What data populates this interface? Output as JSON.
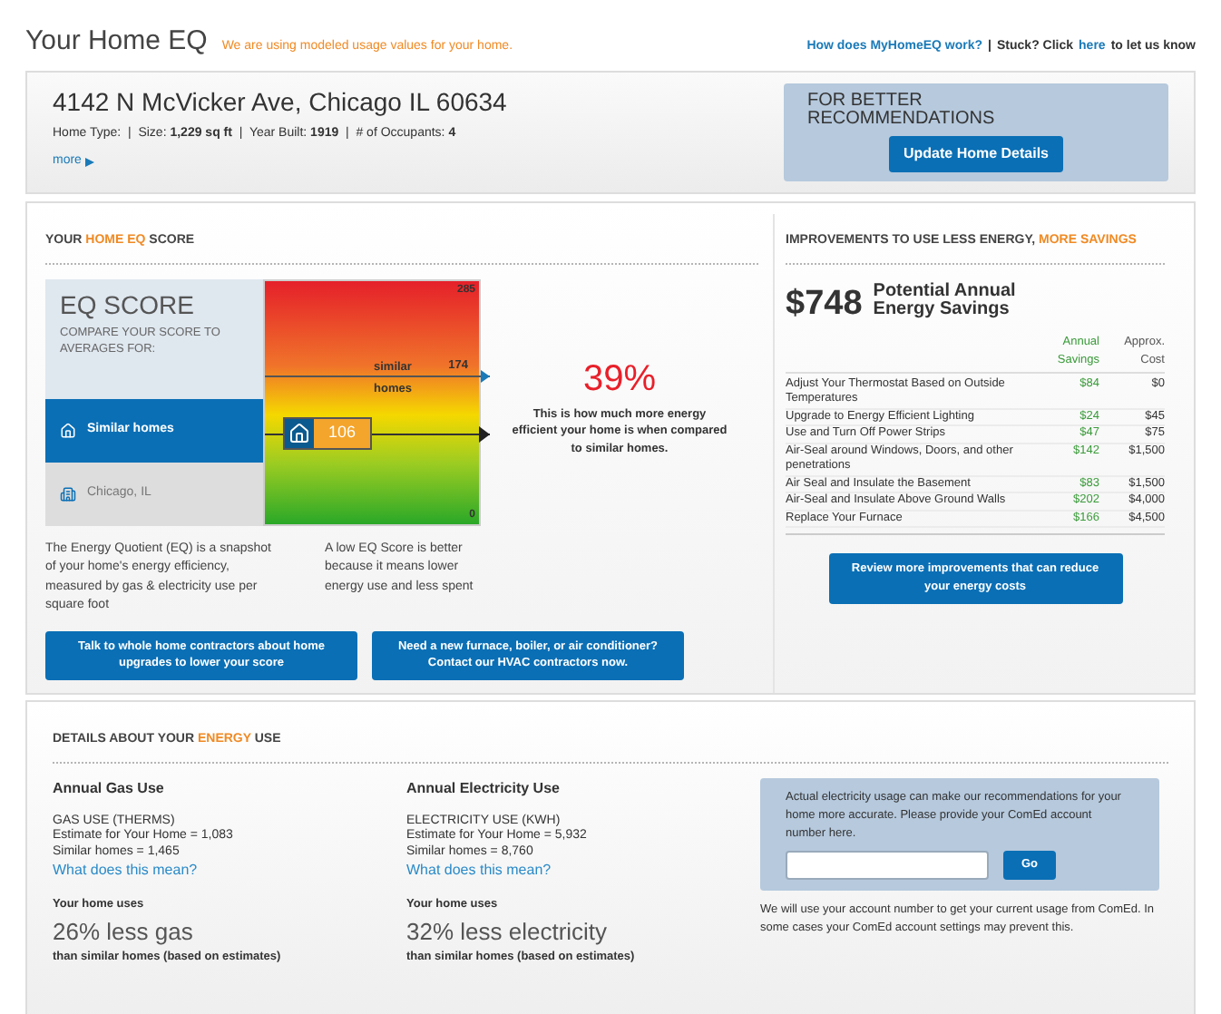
{
  "header": {
    "title": "Your Home EQ",
    "notice": "We are using modeled usage values for your home.",
    "help_link": "How does MyHomeEQ work?",
    "separator": "|",
    "stuck": "Stuck? Click",
    "here_link": "here",
    "stuck_end": "to let us know"
  },
  "home": {
    "address": "4142 N McVicker Ave, Chicago IL 60634",
    "details": "Home Type:  |  Size: **1,229 sq ft**  |  Year Built: **1919**  |  # of Occupants: **4**",
    "more_link": "more"
  },
  "recommend": {
    "title": "FOR BETTER RECOMMENDATIONS",
    "button": "Update Home Details"
  },
  "score": {
    "heading": {
      "before": "YOUR ",
      "highlight": "HOME EQ",
      "after": " SCORE"
    },
    "title": "EQ SCORE",
    "subtitle": "COMPARE YOUR SCORE TO AVERAGES FOR:",
    "options": [
      {
        "kind": "homes",
        "label": "Similar homes",
        "selected": true
      },
      {
        "kind": "city",
        "label": "Chicago, IL",
        "selected": false
      }
    ],
    "gauge": {
      "max": "285",
      "min": "0",
      "similar": {
        "label": "similar homes",
        "value": "174",
        "level": 0.61
      },
      "your_value": "106",
      "level": 0.37
    },
    "percent": "39%",
    "explanation": "This is how much more energy efficient your home is when compared to similar homes.",
    "notes": [
      "The Energy Quotient (EQ) is a snapshot of your home's energy efficiency, measured by gas & electricity use per square foot",
      "A low EQ Score is better because it means lower energy use and less spent"
    ],
    "buttons": [
      "Talk to whole home contractors about home upgrades to lower your score",
      "Need a new furnace, boiler, or air conditioner? Contact our HVAC contractors now."
    ]
  },
  "improvements": {
    "heading": {
      "before": "IMPROVEMENTS TO USE LESS ENERGY, ",
      "highlight": "MORE SAVINGS"
    },
    "amount": "$748",
    "amount_label": "Potential Annual Energy Savings",
    "columns": [
      "Annual Savings",
      "Approx. Cost"
    ],
    "rows": [
      {
        "name": "Adjust Your Thermostat Based on Outside Temperatures",
        "savings": "$84",
        "cost": "$0"
      },
      {
        "name": "Upgrade to Energy Efficient Lighting",
        "savings": "$24",
        "cost": "$45"
      },
      {
        "name": "Use and Turn Off Power Strips",
        "savings": "$47",
        "cost": "$75"
      },
      {
        "name": "Air-Seal around Windows, Doors, and other penetrations",
        "savings": "$142",
        "cost": "$1,500"
      },
      {
        "name": "Air Seal and Insulate the Basement",
        "savings": "$83",
        "cost": "$1,500"
      },
      {
        "name": "Air-Seal and Insulate Above Ground Walls",
        "savings": "$202",
        "cost": "$4,000"
      },
      {
        "name": "Replace Your Furnace",
        "savings": "$166",
        "cost": "$4,500"
      }
    ],
    "button": "Review more improvements that can reduce your energy costs"
  },
  "details": {
    "heading": {
      "before": "DETAILS ABOUT YOUR ",
      "highlight": "ENERGY",
      "after": " USE"
    },
    "usage": [
      {
        "title": "Annual Gas Use",
        "lines": [
          "GAS USE (THERMS)",
          "Estimate for Your Home = 1,083",
          "Similar homes = 1,465"
        ],
        "link": "What does this mean?",
        "uses": "Your home uses",
        "big": "26% less gas",
        "note": "than similar homes (based on estimates)"
      },
      {
        "title": "Annual Electricity Use",
        "lines": [
          "ELECTRICITY USE (KWH)",
          "Estimate for Your Home = 5,932",
          "Similar homes = 8,760"
        ],
        "link": "What does this mean?",
        "uses": "Your home uses",
        "big": "32% less electricity",
        "note": "than similar homes (based on estimates)"
      }
    ],
    "account": {
      "text": "Actual electricity usage can make our recommendations for your home more accurate. Please provide your ComEd account number here.",
      "button": "Go",
      "note": "We will use your account number to get your current usage from ComEd. In some cases your ComEd account settings may prevent this."
    }
  }
}
